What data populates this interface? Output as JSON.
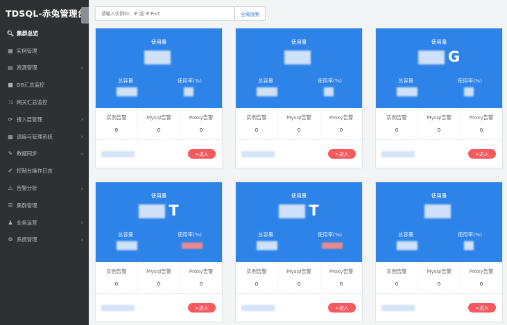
{
  "brand": {
    "title": "TDSQL-赤兔管理台"
  },
  "search": {
    "placeholder": "请输入实例ID、IP 或 IP:Port",
    "button": "全局搜索"
  },
  "sidebar": {
    "items": [
      {
        "icon": "search-icon",
        "glyph": "🔍︎",
        "label": "集群总览",
        "active": true,
        "has_children": false
      },
      {
        "icon": "grid-icon",
        "glyph": "▦",
        "label": "实例管理",
        "active": false,
        "has_children": false
      },
      {
        "icon": "database-icon",
        "glyph": "▤",
        "label": "资源管理",
        "active": false,
        "has_children": true
      },
      {
        "icon": "monitor-icon",
        "glyph": "■",
        "label": "DB汇总监控",
        "active": false,
        "has_children": false
      },
      {
        "icon": "shuffle-icon",
        "glyph": "⤨",
        "label": "网关汇总监控",
        "active": false,
        "has_children": false
      },
      {
        "icon": "refresh-icon",
        "glyph": "⟳",
        "label": "接入层管理",
        "active": false,
        "has_children": true
      },
      {
        "icon": "apps-icon",
        "glyph": "▦",
        "label": "调度与管理系统",
        "active": false,
        "has_children": true
      },
      {
        "icon": "pen-icon",
        "glyph": "✎",
        "label": "数据同步",
        "active": false,
        "has_children": true
      },
      {
        "icon": "wrench-icon",
        "glyph": "✐",
        "label": "控制台操作日志",
        "active": false,
        "has_children": false
      },
      {
        "icon": "warning-icon",
        "glyph": "⚠",
        "label": "告警分析",
        "active": false,
        "has_children": true
      },
      {
        "icon": "list-icon",
        "glyph": "☰",
        "label": "集群管理",
        "active": false,
        "has_children": false
      },
      {
        "icon": "users-icon",
        "glyph": "♟",
        "label": "业务运营",
        "active": false,
        "has_children": true
      },
      {
        "icon": "gear-icon",
        "glyph": "⚙",
        "label": "系统管理",
        "active": false,
        "has_children": true
      }
    ],
    "chevron": "›"
  },
  "cards": [
    {
      "usage_label": "使用量",
      "usage_unit": "",
      "total_label": "总容量",
      "rate_label": "使用率(%)",
      "rate_hot": false,
      "alarms": [
        {
          "label": "实例告警",
          "count": "0"
        },
        {
          "label": "Mysql告警",
          "count": "0"
        },
        {
          "label": "Proxy告警",
          "count": "0"
        }
      ],
      "enter": ">进入"
    },
    {
      "usage_label": "使用量",
      "usage_unit": "",
      "total_label": "总容量",
      "rate_label": "使用率(%)",
      "rate_hot": false,
      "alarms": [
        {
          "label": "实例告警",
          "count": "0"
        },
        {
          "label": "Mysql告警",
          "count": "0"
        },
        {
          "label": "Proxy告警",
          "count": "0"
        }
      ],
      "enter": ">进入"
    },
    {
      "usage_label": "使用量",
      "usage_unit": "G",
      "total_label": "总容量",
      "rate_label": "使用率(%)",
      "rate_hot": false,
      "alarms": [
        {
          "label": "实例告警",
          "count": "0"
        },
        {
          "label": "Mysql告警",
          "count": "0"
        },
        {
          "label": "Proxy告警",
          "count": "0"
        }
      ],
      "enter": ">进入"
    },
    {
      "usage_label": "使用量",
      "usage_unit": "T",
      "total_label": "总容量",
      "rate_label": "使用率(%)",
      "rate_hot": true,
      "alarms": [
        {
          "label": "实例告警",
          "count": "0"
        },
        {
          "label": "Mysql告警",
          "count": "0"
        },
        {
          "label": "Proxy告警",
          "count": "0"
        }
      ],
      "enter": ">进入"
    },
    {
      "usage_label": "使用量",
      "usage_unit": "T",
      "total_label": "总容量",
      "rate_label": "使用率(%)",
      "rate_hot": true,
      "alarms": [
        {
          "label": "实例告警",
          "count": "0"
        },
        {
          "label": "Mysql告警",
          "count": "0"
        },
        {
          "label": "Proxy告警",
          "count": "0"
        }
      ],
      "enter": ">进入"
    },
    {
      "usage_label": "使用量",
      "usage_unit": "",
      "total_label": "总容量",
      "rate_label": "使用率(%)",
      "rate_hot": false,
      "alarms": [
        {
          "label": "实例告警",
          "count": "0"
        },
        {
          "label": "Mysql告警",
          "count": "0"
        },
        {
          "label": "Proxy告警",
          "count": "0"
        }
      ],
      "enter": ">进入"
    }
  ],
  "colors": {
    "sidebar_bg": "#2f3033",
    "card_header": "#2e83e8",
    "enter_button": "#f4595d",
    "search_button_text": "#3a79d8"
  }
}
